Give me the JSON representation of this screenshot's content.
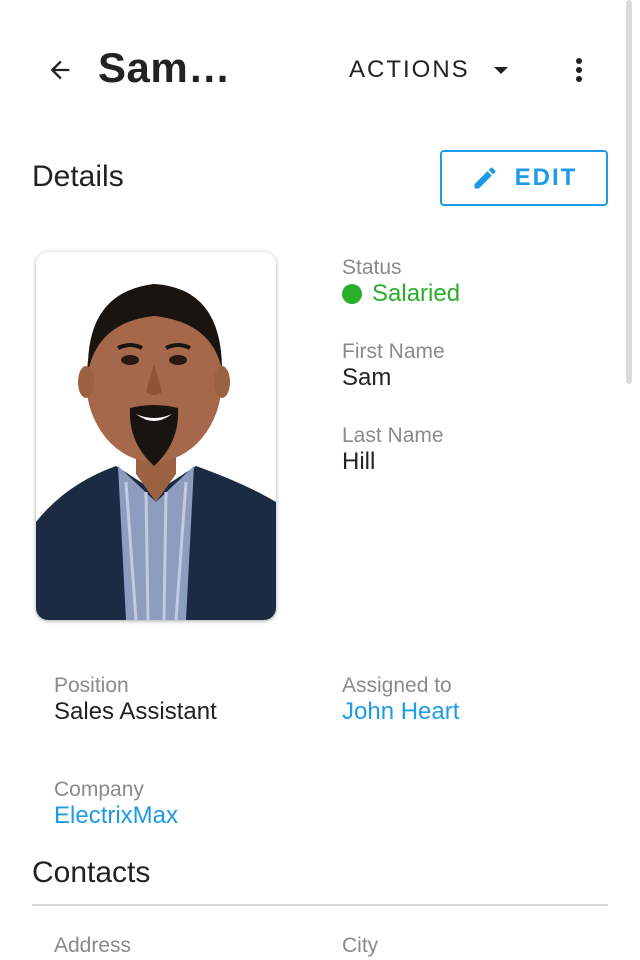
{
  "header": {
    "title": "Sam…",
    "actions_label": "ACTIONS"
  },
  "details": {
    "heading": "Details",
    "edit_label": "EDIT",
    "status": {
      "label": "Status",
      "value": "Salaried",
      "color": "#2bae2b"
    },
    "first_name": {
      "label": "First Name",
      "value": "Sam"
    },
    "last_name": {
      "label": "Last Name",
      "value": "Hill"
    },
    "position": {
      "label": "Position",
      "value": "Sales Assistant"
    },
    "assigned_to": {
      "label": "Assigned to",
      "value": "John Heart"
    },
    "company": {
      "label": "Company",
      "value": "ElectrixMax"
    }
  },
  "contacts": {
    "heading": "Contacts",
    "address_label": "Address",
    "city_label": "City"
  },
  "colors": {
    "accent": "#1e9be6",
    "status_green": "#2bae2b"
  },
  "icons": {
    "back": "arrow-left-icon",
    "caret": "caret-down-icon",
    "more": "more-vert-icon",
    "edit": "pencil-icon"
  }
}
